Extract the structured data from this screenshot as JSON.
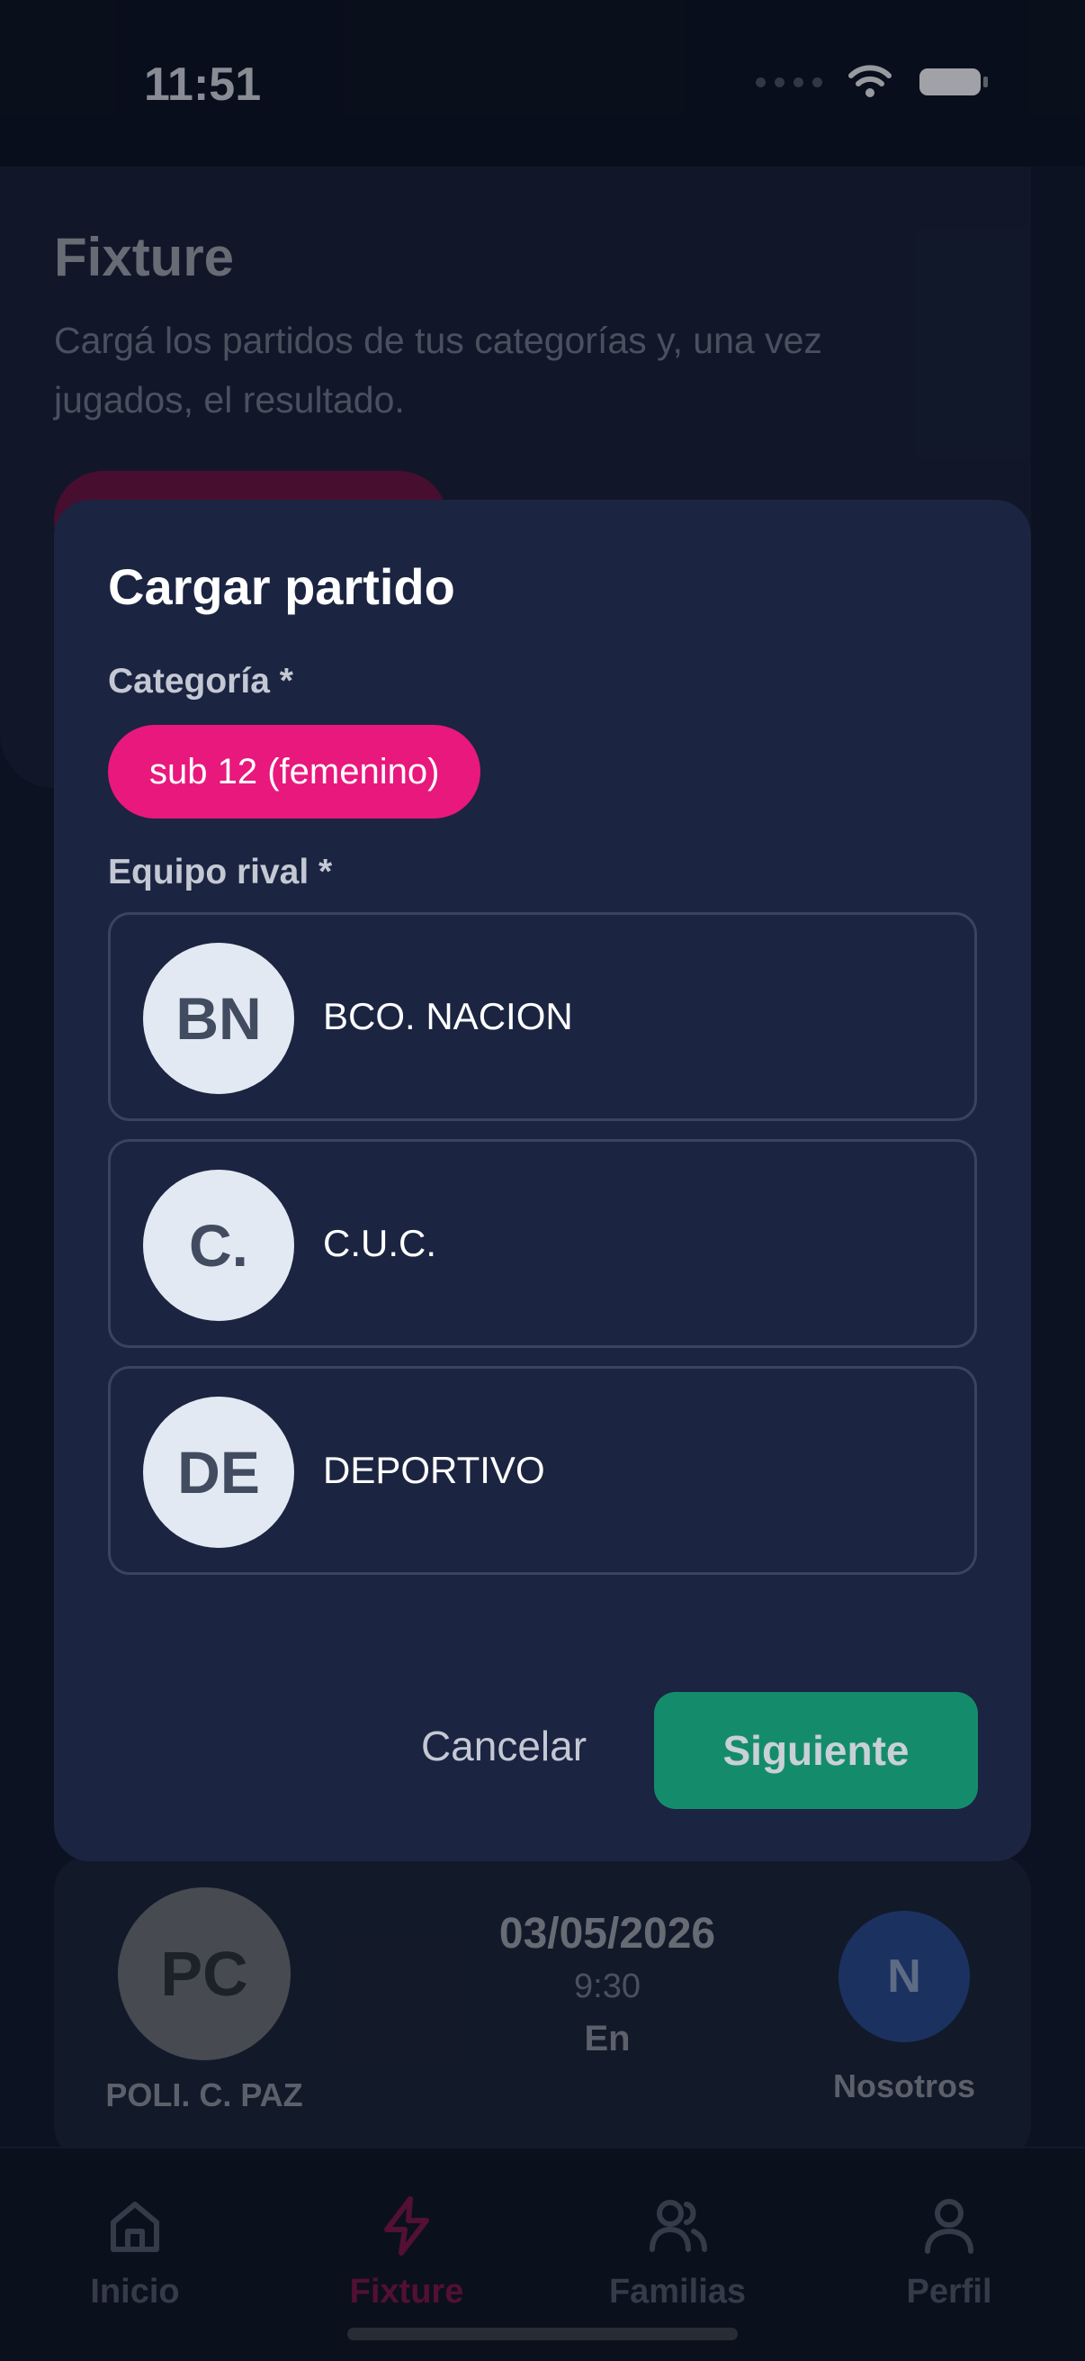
{
  "status_bar": {
    "time": "11:51"
  },
  "page": {
    "title": "Fixture",
    "subtitle": "Cargá los partidos de tus categorías y, una vez jugados, el resultado."
  },
  "match": {
    "home_initials": "PC",
    "home_name": "POLI. C. PAZ",
    "date": "03/05/2026",
    "time": "9:30",
    "venue": "En",
    "away_initials": "N",
    "away_name": "Nosotros"
  },
  "modal": {
    "title": "Cargar partido",
    "category_label": "Categoría *",
    "category_selected": "sub 12 (femenino)",
    "rival_label": "Equipo rival *",
    "teams": [
      {
        "initials": "BN",
        "name": "BCO. NACION"
      },
      {
        "initials": "C.",
        "name": "C.U.C."
      },
      {
        "initials": "DE",
        "name": "DEPORTIVO"
      }
    ],
    "cancel_label": "Cancelar",
    "next_label": "Siguiente"
  },
  "tabbar": {
    "items": [
      {
        "label": "Inicio",
        "icon": "home-icon"
      },
      {
        "label": "Fixture",
        "icon": "lightning-icon"
      },
      {
        "label": "Familias",
        "icon": "users-icon"
      },
      {
        "label": "Perfil",
        "icon": "user-icon"
      }
    ],
    "active_index": 1
  },
  "colors": {
    "accent": "#e8187c",
    "primary_button": "#148c6c",
    "modal_bg": "#1b2441",
    "page_bg": "#0c1222"
  }
}
